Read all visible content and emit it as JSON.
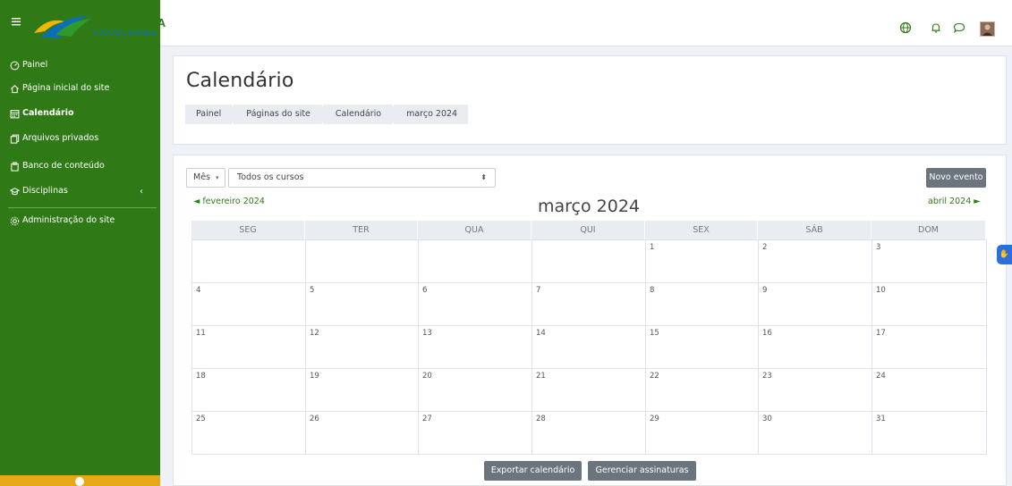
{
  "brand": {
    "name": "BRASILIANA",
    "sub": "FACULDADE"
  },
  "sidebar": {
    "items": [
      {
        "label": "Painel",
        "icon": "dashboard-icon"
      },
      {
        "label": "Página inicial do site",
        "icon": "home-icon"
      },
      {
        "label": "Calendário",
        "icon": "calendar-icon",
        "active": true
      },
      {
        "label": "Arquivos privados",
        "icon": "files-icon"
      },
      {
        "label": "Banco de conteúdo",
        "icon": "content-bank-icon"
      },
      {
        "label": "Disciplinas",
        "icon": "graduation-cap-icon"
      },
      {
        "label": "Administração do site",
        "icon": "gear-icon"
      }
    ]
  },
  "page": {
    "title": "Calendário",
    "breadcrumb": [
      "Painel",
      "Páginas do site",
      "Calendário",
      "março 2024"
    ]
  },
  "controls": {
    "view_select": "Mês",
    "course_select": "Todos os cursos",
    "new_event": "Novo evento"
  },
  "calendar": {
    "prev": "◄ fevereiro 2024",
    "next": "abril 2024 ►",
    "month": "março 2024",
    "weekdays": [
      "SEG",
      "TER",
      "QUA",
      "QUI",
      "SEX",
      "SÁB",
      "DOM"
    ],
    "weeks": [
      [
        "",
        "",
        "",
        "",
        "1",
        "2",
        "3"
      ],
      [
        "4",
        "5",
        "6",
        "7",
        "8",
        "9",
        "10"
      ],
      [
        "11",
        "12",
        "13",
        "14",
        "15",
        "16",
        "17"
      ],
      [
        "18",
        "19",
        "20",
        "21",
        "22",
        "23",
        "24"
      ],
      [
        "25",
        "26",
        "27",
        "28",
        "29",
        "30",
        "31"
      ]
    ]
  },
  "footer_buttons": {
    "export": "Exportar calendário",
    "manage": "Gerenciar assinaturas"
  },
  "colors": {
    "primary_green": "#2f7a16",
    "accent_yellow": "#e6a817",
    "button_gray": "#6c757d",
    "side_tab_blue": "#2a6fdb"
  }
}
